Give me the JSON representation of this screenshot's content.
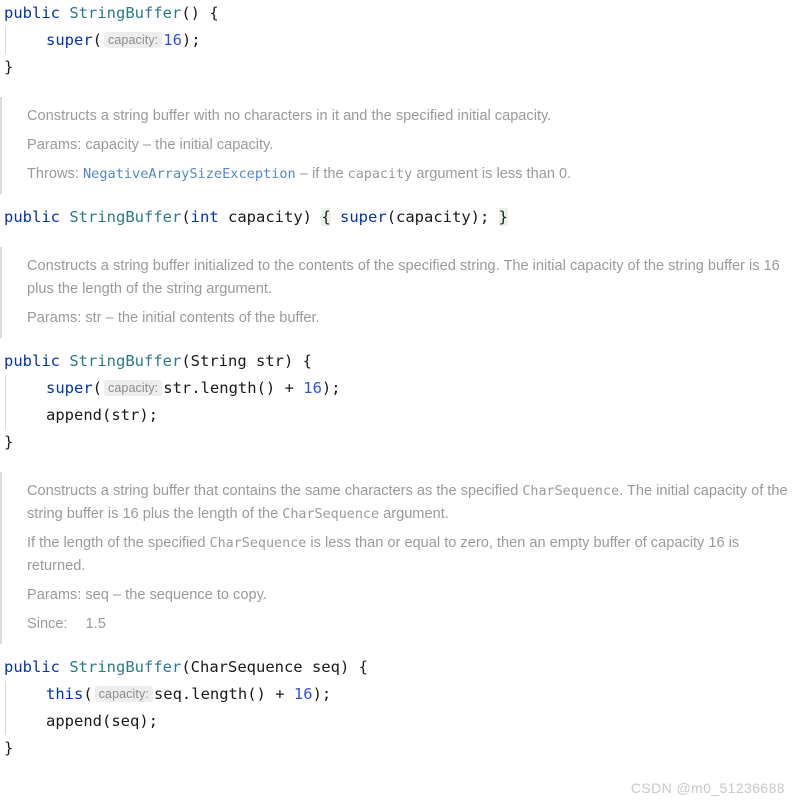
{
  "colors": {
    "background": "#ffffff",
    "keyword": "#0033b3",
    "type_name": "#2a7b8c",
    "number": "#2f52e0",
    "plain_code": "#1a1a1a",
    "doc_text": "#9a9a9a",
    "doc_link": "#5588c7",
    "brace_highlight_bg": "#e7f3e8",
    "param_hint_bg": "#ededed",
    "param_hint_fg": "#8c8c8c",
    "doc_border": "#dcdcdc",
    "indent_guide": "#d8d8d8",
    "watermark": "#c9c9c9"
  },
  "editor": {
    "language": "java",
    "param_hint_label": "capacity:",
    "blocks": [
      {
        "id": "ctor-no-arg",
        "kind": "code",
        "lines": [
          {
            "indent": 0,
            "tokens": [
              {
                "t": "public",
                "c": "kw"
              },
              {
                "t": " ",
                "c": "plain"
              },
              {
                "t": "StringBuffer",
                "c": "type"
              },
              {
                "t": "() {",
                "c": "plain"
              }
            ]
          },
          {
            "indent": 1,
            "tokens": [
              {
                "t": "super",
                "c": "kw"
              },
              {
                "t": "(",
                "c": "plain"
              },
              {
                "t": "capacity:",
                "c": "hint"
              },
              {
                "t": "16",
                "c": "num"
              },
              {
                "t": ");",
                "c": "plain"
              }
            ]
          },
          {
            "indent": 0,
            "tokens": [
              {
                "t": "}",
                "c": "plain"
              }
            ]
          }
        ]
      },
      {
        "id": "doc-int-capacity",
        "kind": "doc",
        "paragraphs": [
          {
            "runs": [
              {
                "t": "Constructs a string buffer with no characters in it and the specified initial capacity.",
                "c": "text"
              }
            ]
          },
          {
            "runs": [
              {
                "t": "Params: capacity – the initial capacity.",
                "c": "text"
              }
            ]
          },
          {
            "runs": [
              {
                "t": "Throws: ",
                "c": "text"
              },
              {
                "t": "NegativeArraySizeException",
                "c": "link"
              },
              {
                "t": " – if the ",
                "c": "text"
              },
              {
                "t": "capacity",
                "c": "mono"
              },
              {
                "t": " argument is less than 0.",
                "c": "text"
              }
            ]
          }
        ]
      },
      {
        "id": "ctor-int-capacity",
        "kind": "code",
        "lines": [
          {
            "indent": 0,
            "tokens": [
              {
                "t": "public",
                "c": "kw"
              },
              {
                "t": " ",
                "c": "plain"
              },
              {
                "t": "StringBuffer",
                "c": "type"
              },
              {
                "t": "(",
                "c": "plain"
              },
              {
                "t": "int",
                "c": "kw"
              },
              {
                "t": " capacity) ",
                "c": "plain"
              },
              {
                "t": "{",
                "c": "brace-hl"
              },
              {
                "t": " ",
                "c": "plain"
              },
              {
                "t": "super",
                "c": "kw"
              },
              {
                "t": "(capacity); ",
                "c": "plain"
              },
              {
                "t": "}",
                "c": "brace-hl"
              }
            ]
          }
        ]
      },
      {
        "id": "doc-string-str",
        "kind": "doc",
        "paragraphs": [
          {
            "runs": [
              {
                "t": "Constructs a string buffer initialized to the contents of the specified string. The initial capacity of the string buffer is 16 plus the length of the string argument.",
                "c": "text"
              }
            ]
          },
          {
            "runs": [
              {
                "t": "Params: str – the initial contents of the buffer.",
                "c": "text"
              }
            ]
          }
        ]
      },
      {
        "id": "ctor-string-str",
        "kind": "code",
        "lines": [
          {
            "indent": 0,
            "tokens": [
              {
                "t": "public",
                "c": "kw"
              },
              {
                "t": " ",
                "c": "plain"
              },
              {
                "t": "StringBuffer",
                "c": "type"
              },
              {
                "t": "(String str) {",
                "c": "plain"
              }
            ]
          },
          {
            "indent": 1,
            "tokens": [
              {
                "t": "super",
                "c": "kw"
              },
              {
                "t": "(",
                "c": "plain"
              },
              {
                "t": "capacity:",
                "c": "hint"
              },
              {
                "t": "str.length() + ",
                "c": "plain"
              },
              {
                "t": "16",
                "c": "num"
              },
              {
                "t": ");",
                "c": "plain"
              }
            ]
          },
          {
            "indent": 1,
            "tokens": [
              {
                "t": "append(str);",
                "c": "plain"
              }
            ]
          },
          {
            "indent": 0,
            "tokens": [
              {
                "t": "}",
                "c": "plain"
              }
            ]
          }
        ]
      },
      {
        "id": "doc-charsequence-seq",
        "kind": "doc",
        "paragraphs": [
          {
            "runs": [
              {
                "t": "Constructs a string buffer that contains the same characters as the specified ",
                "c": "text"
              },
              {
                "t": "CharSequence",
                "c": "mono"
              },
              {
                "t": ". The initial capacity of the string buffer is 16 plus the length of the ",
                "c": "text"
              },
              {
                "t": "CharSequence",
                "c": "mono"
              },
              {
                "t": " argument.",
                "c": "text"
              }
            ]
          },
          {
            "runs": [
              {
                "t": "If the length of the specified ",
                "c": "text"
              },
              {
                "t": "CharSequence",
                "c": "mono"
              },
              {
                "t": " is less than or equal to zero, then an empty buffer of capacity 16 is returned.",
                "c": "text"
              }
            ]
          },
          {
            "runs": [
              {
                "t": "Params: seq – the sequence to copy.",
                "c": "text"
              }
            ]
          },
          {
            "runs": [
              {
                "t": "Since:",
                "c": "text"
              },
              {
                "t": "1.5",
                "c": "since-val"
              }
            ]
          }
        ]
      },
      {
        "id": "ctor-charsequence-seq",
        "kind": "code",
        "lines": [
          {
            "indent": 0,
            "tokens": [
              {
                "t": "public",
                "c": "kw"
              },
              {
                "t": " ",
                "c": "plain"
              },
              {
                "t": "StringBuffer",
                "c": "type"
              },
              {
                "t": "(CharSequence seq) {",
                "c": "plain"
              }
            ]
          },
          {
            "indent": 1,
            "tokens": [
              {
                "t": "this",
                "c": "kw"
              },
              {
                "t": "(",
                "c": "plain"
              },
              {
                "t": "capacity:",
                "c": "hint"
              },
              {
                "t": "seq.length() + ",
                "c": "plain"
              },
              {
                "t": "16",
                "c": "num"
              },
              {
                "t": ");",
                "c": "plain"
              }
            ]
          },
          {
            "indent": 1,
            "tokens": [
              {
                "t": "append(seq);",
                "c": "plain"
              }
            ]
          },
          {
            "indent": 0,
            "tokens": [
              {
                "t": "}",
                "c": "plain"
              }
            ]
          }
        ]
      }
    ]
  },
  "watermark": {
    "text": "CSDN @m0_51236688"
  }
}
